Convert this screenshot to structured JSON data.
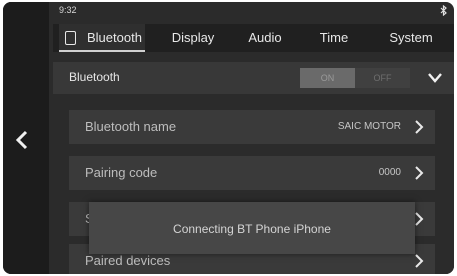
{
  "status_bar": {
    "time": "9:32",
    "bluetooth_icon": "bluetooth-icon"
  },
  "tabs": [
    {
      "label": "Bluetooth",
      "icon": "bluetooth-tab-icon",
      "active": true
    },
    {
      "label": "Display"
    },
    {
      "label": "Audio"
    },
    {
      "label": "Time"
    },
    {
      "label": "System"
    }
  ],
  "header": {
    "title": "Bluetooth",
    "toggle_on_label": "ON",
    "toggle_off_label": "OFF",
    "expand_icon": "chevron-down-icon"
  },
  "list": [
    {
      "label": "Bluetooth name",
      "value": "SAIC MOTOR"
    },
    {
      "label": "Pairing code",
      "value": "0000"
    },
    {
      "label": "S",
      "value": ""
    },
    {
      "label": "Paired devices",
      "value": ""
    }
  ],
  "toast": {
    "text": "Connecting BT Phone iPhone"
  },
  "colors": {
    "background": "#2b2b2b",
    "side_panel": "#1c1c1c",
    "list_item": "#3a3a3a",
    "toast": "#474747"
  }
}
